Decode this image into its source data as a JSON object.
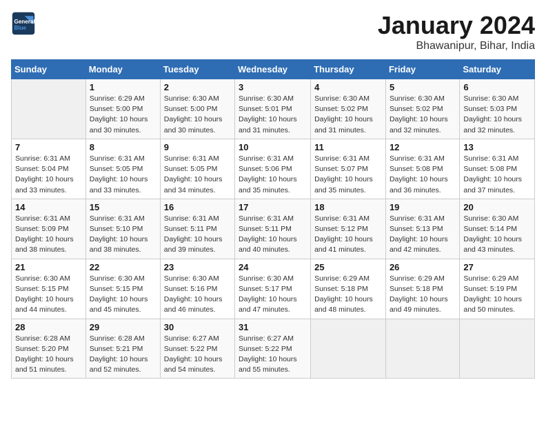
{
  "header": {
    "logo_line1": "General",
    "logo_line2": "Blue",
    "title": "January 2024",
    "subtitle": "Bhawanipur, Bihar, India"
  },
  "weekdays": [
    "Sunday",
    "Monday",
    "Tuesday",
    "Wednesday",
    "Thursday",
    "Friday",
    "Saturday"
  ],
  "weeks": [
    [
      {
        "day": "",
        "info": ""
      },
      {
        "day": "1",
        "info": "Sunrise: 6:29 AM\nSunset: 5:00 PM\nDaylight: 10 hours\nand 30 minutes."
      },
      {
        "day": "2",
        "info": "Sunrise: 6:30 AM\nSunset: 5:00 PM\nDaylight: 10 hours\nand 30 minutes."
      },
      {
        "day": "3",
        "info": "Sunrise: 6:30 AM\nSunset: 5:01 PM\nDaylight: 10 hours\nand 31 minutes."
      },
      {
        "day": "4",
        "info": "Sunrise: 6:30 AM\nSunset: 5:02 PM\nDaylight: 10 hours\nand 31 minutes."
      },
      {
        "day": "5",
        "info": "Sunrise: 6:30 AM\nSunset: 5:02 PM\nDaylight: 10 hours\nand 32 minutes."
      },
      {
        "day": "6",
        "info": "Sunrise: 6:30 AM\nSunset: 5:03 PM\nDaylight: 10 hours\nand 32 minutes."
      }
    ],
    [
      {
        "day": "7",
        "info": "Sunrise: 6:31 AM\nSunset: 5:04 PM\nDaylight: 10 hours\nand 33 minutes."
      },
      {
        "day": "8",
        "info": "Sunrise: 6:31 AM\nSunset: 5:05 PM\nDaylight: 10 hours\nand 33 minutes."
      },
      {
        "day": "9",
        "info": "Sunrise: 6:31 AM\nSunset: 5:05 PM\nDaylight: 10 hours\nand 34 minutes."
      },
      {
        "day": "10",
        "info": "Sunrise: 6:31 AM\nSunset: 5:06 PM\nDaylight: 10 hours\nand 35 minutes."
      },
      {
        "day": "11",
        "info": "Sunrise: 6:31 AM\nSunset: 5:07 PM\nDaylight: 10 hours\nand 35 minutes."
      },
      {
        "day": "12",
        "info": "Sunrise: 6:31 AM\nSunset: 5:08 PM\nDaylight: 10 hours\nand 36 minutes."
      },
      {
        "day": "13",
        "info": "Sunrise: 6:31 AM\nSunset: 5:08 PM\nDaylight: 10 hours\nand 37 minutes."
      }
    ],
    [
      {
        "day": "14",
        "info": "Sunrise: 6:31 AM\nSunset: 5:09 PM\nDaylight: 10 hours\nand 38 minutes."
      },
      {
        "day": "15",
        "info": "Sunrise: 6:31 AM\nSunset: 5:10 PM\nDaylight: 10 hours\nand 38 minutes."
      },
      {
        "day": "16",
        "info": "Sunrise: 6:31 AM\nSunset: 5:11 PM\nDaylight: 10 hours\nand 39 minutes."
      },
      {
        "day": "17",
        "info": "Sunrise: 6:31 AM\nSunset: 5:11 PM\nDaylight: 10 hours\nand 40 minutes."
      },
      {
        "day": "18",
        "info": "Sunrise: 6:31 AM\nSunset: 5:12 PM\nDaylight: 10 hours\nand 41 minutes."
      },
      {
        "day": "19",
        "info": "Sunrise: 6:31 AM\nSunset: 5:13 PM\nDaylight: 10 hours\nand 42 minutes."
      },
      {
        "day": "20",
        "info": "Sunrise: 6:30 AM\nSunset: 5:14 PM\nDaylight: 10 hours\nand 43 minutes."
      }
    ],
    [
      {
        "day": "21",
        "info": "Sunrise: 6:30 AM\nSunset: 5:15 PM\nDaylight: 10 hours\nand 44 minutes."
      },
      {
        "day": "22",
        "info": "Sunrise: 6:30 AM\nSunset: 5:15 PM\nDaylight: 10 hours\nand 45 minutes."
      },
      {
        "day": "23",
        "info": "Sunrise: 6:30 AM\nSunset: 5:16 PM\nDaylight: 10 hours\nand 46 minutes."
      },
      {
        "day": "24",
        "info": "Sunrise: 6:30 AM\nSunset: 5:17 PM\nDaylight: 10 hours\nand 47 minutes."
      },
      {
        "day": "25",
        "info": "Sunrise: 6:29 AM\nSunset: 5:18 PM\nDaylight: 10 hours\nand 48 minutes."
      },
      {
        "day": "26",
        "info": "Sunrise: 6:29 AM\nSunset: 5:18 PM\nDaylight: 10 hours\nand 49 minutes."
      },
      {
        "day": "27",
        "info": "Sunrise: 6:29 AM\nSunset: 5:19 PM\nDaylight: 10 hours\nand 50 minutes."
      }
    ],
    [
      {
        "day": "28",
        "info": "Sunrise: 6:28 AM\nSunset: 5:20 PM\nDaylight: 10 hours\nand 51 minutes."
      },
      {
        "day": "29",
        "info": "Sunrise: 6:28 AM\nSunset: 5:21 PM\nDaylight: 10 hours\nand 52 minutes."
      },
      {
        "day": "30",
        "info": "Sunrise: 6:27 AM\nSunset: 5:22 PM\nDaylight: 10 hours\nand 54 minutes."
      },
      {
        "day": "31",
        "info": "Sunrise: 6:27 AM\nSunset: 5:22 PM\nDaylight: 10 hours\nand 55 minutes."
      },
      {
        "day": "",
        "info": ""
      },
      {
        "day": "",
        "info": ""
      },
      {
        "day": "",
        "info": ""
      }
    ]
  ]
}
